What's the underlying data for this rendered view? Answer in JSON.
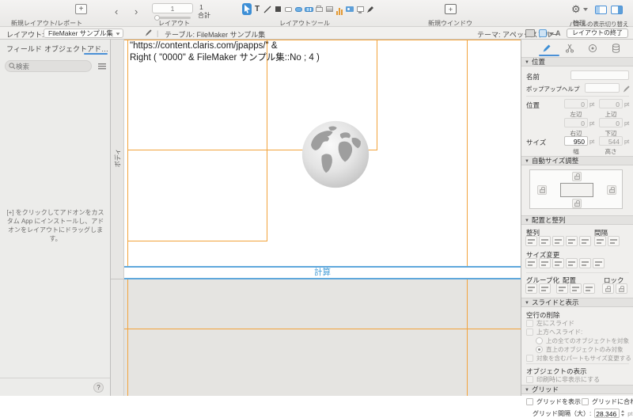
{
  "toolbar": {
    "new_layout_label": "新規レイアウト/レポート",
    "nav_label": "レイアウト",
    "current_page": "1",
    "total_value": "1",
    "total_label": "合計",
    "tools_label": "レイアウトツール",
    "new_window_label": "新規ウインドウ",
    "manage_label": "管理",
    "panels_label": "パネルの表示切り替え"
  },
  "layoutbar": {
    "layout_label": "レイアウト:",
    "layout_selector": "FileMaker サンプル集",
    "table_info": "テーブル: FileMaker サンプル集",
    "theme_info": "テーマ: アペックスブルー",
    "exit_button": "レイアウトの終了"
  },
  "sidebar": {
    "tabs": [
      {
        "label": "フィールド"
      },
      {
        "label": "オブジェクト"
      },
      {
        "label": "アド…"
      }
    ],
    "search_placeholder": "検索",
    "hint_text": "[+] をクリックしてアドオンをカスタム App にインストールし、アドオンをレイアウトにドラッグします。"
  },
  "canvas": {
    "part_label": "ボディ",
    "formula_line1": "\"https://content.claris.com/jpapps/\" &",
    "formula_line2": "Right ( \"0000\" & FileMaker サンプル集::No ; 4 )",
    "field_placeholder": "計算",
    "colors": {
      "object_border": "#f2a33c",
      "selection_blue": "#5fa8dc",
      "calc_text": "#3f9ad6"
    }
  },
  "inspector": {
    "sections": {
      "position": "位置",
      "autosize": "自動サイズ調整",
      "arrange": "配置と整列",
      "sliding": "スライドと表示",
      "grid": "グリッド"
    },
    "name_label": "名前",
    "tooltip_label": "ポップアップヘルプ",
    "position_label": "位置",
    "unit": "pt",
    "pos": {
      "left": {
        "label": "左辺",
        "value": "0"
      },
      "top": {
        "label": "上辺",
        "value": "0"
      },
      "right": {
        "label": "右辺",
        "value": "0"
      },
      "bottom": {
        "label": "下辺",
        "value": "0"
      }
    },
    "size_label": "サイズ",
    "size": {
      "width": {
        "label": "幅",
        "value": "950"
      },
      "height": {
        "label": "高さ",
        "value": "544"
      }
    },
    "align_label": "整列",
    "space_label": "間隔",
    "resize_label": "サイズ変更",
    "group_label": "グループ化",
    "arrange_label": "配置",
    "lock_label": "ロック",
    "blank_removal_label": "空行の削除",
    "slide_left": "左にスライド",
    "slide_up": "上方へスライド:",
    "slide_opt_all": "上の全てのオブジェクトを対象",
    "slide_opt_direct": "直上のオブジェクトのみ対象",
    "resize_enclosing": "対象を含むパートもサイズ変更する",
    "object_display_label": "オブジェクトの表示",
    "hide_when_printing": "印刷時に非表示にする",
    "show_grid": "グリッドを表示",
    "snap_grid": "グリッドに合わせる",
    "grid_spacing_label": "グリッド間隔（大）:",
    "grid_spacing_value": "28.346"
  },
  "icons": {
    "text_tool": "T",
    "gear": "⚙",
    "chevron_left": "‹",
    "chevron_right": "›",
    "disclosure": "▼",
    "plus": "+",
    "help": "?"
  }
}
